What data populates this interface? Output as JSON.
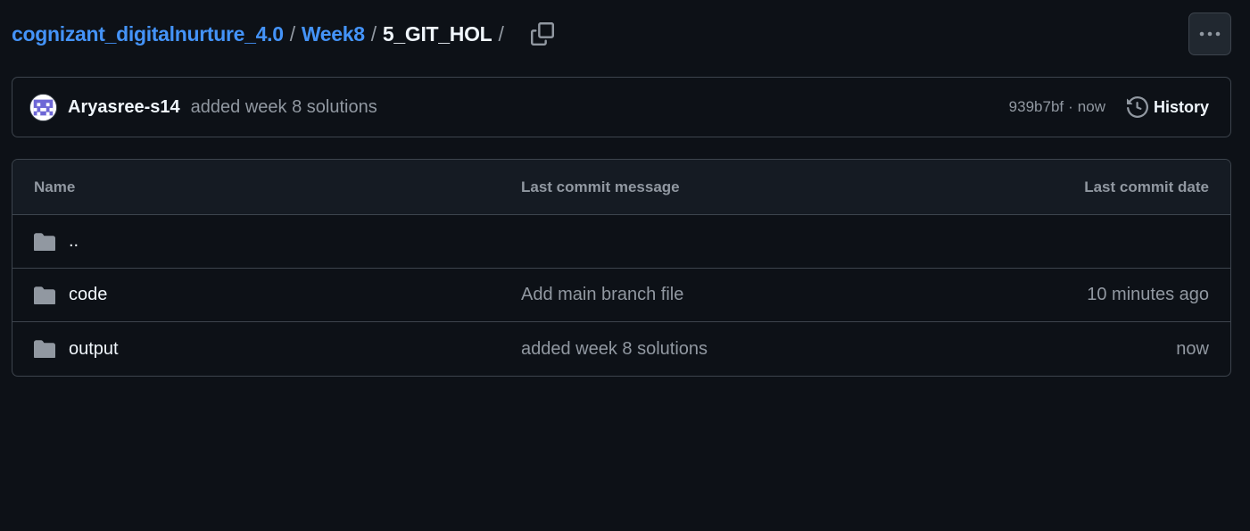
{
  "breadcrumb": {
    "repo": "cognizant_digitalnurture_4.0",
    "folder": "Week8",
    "current": "5_GIT_HOL",
    "separator": "/"
  },
  "latest_commit": {
    "author": "Aryasree-s14",
    "message": "added week 8 solutions",
    "sha": "939b7bf",
    "separator": "·",
    "time": "now",
    "history_label": "History"
  },
  "file_table": {
    "headers": {
      "name": "Name",
      "message": "Last commit message",
      "date": "Last commit date"
    },
    "rows": [
      {
        "name": "..",
        "message": "",
        "date": "",
        "icon": "folder-icon"
      },
      {
        "name": "code",
        "message": "Add main branch file",
        "date": "10 minutes ago",
        "icon": "folder-icon"
      },
      {
        "name": "output",
        "message": "added week 8 solutions",
        "date": "now",
        "icon": "folder-icon"
      }
    ]
  },
  "colors": {
    "background": "#0d1117",
    "link": "#4493f8",
    "muted": "#9198a1",
    "border": "#3d444d",
    "folder": "#9198a1"
  }
}
